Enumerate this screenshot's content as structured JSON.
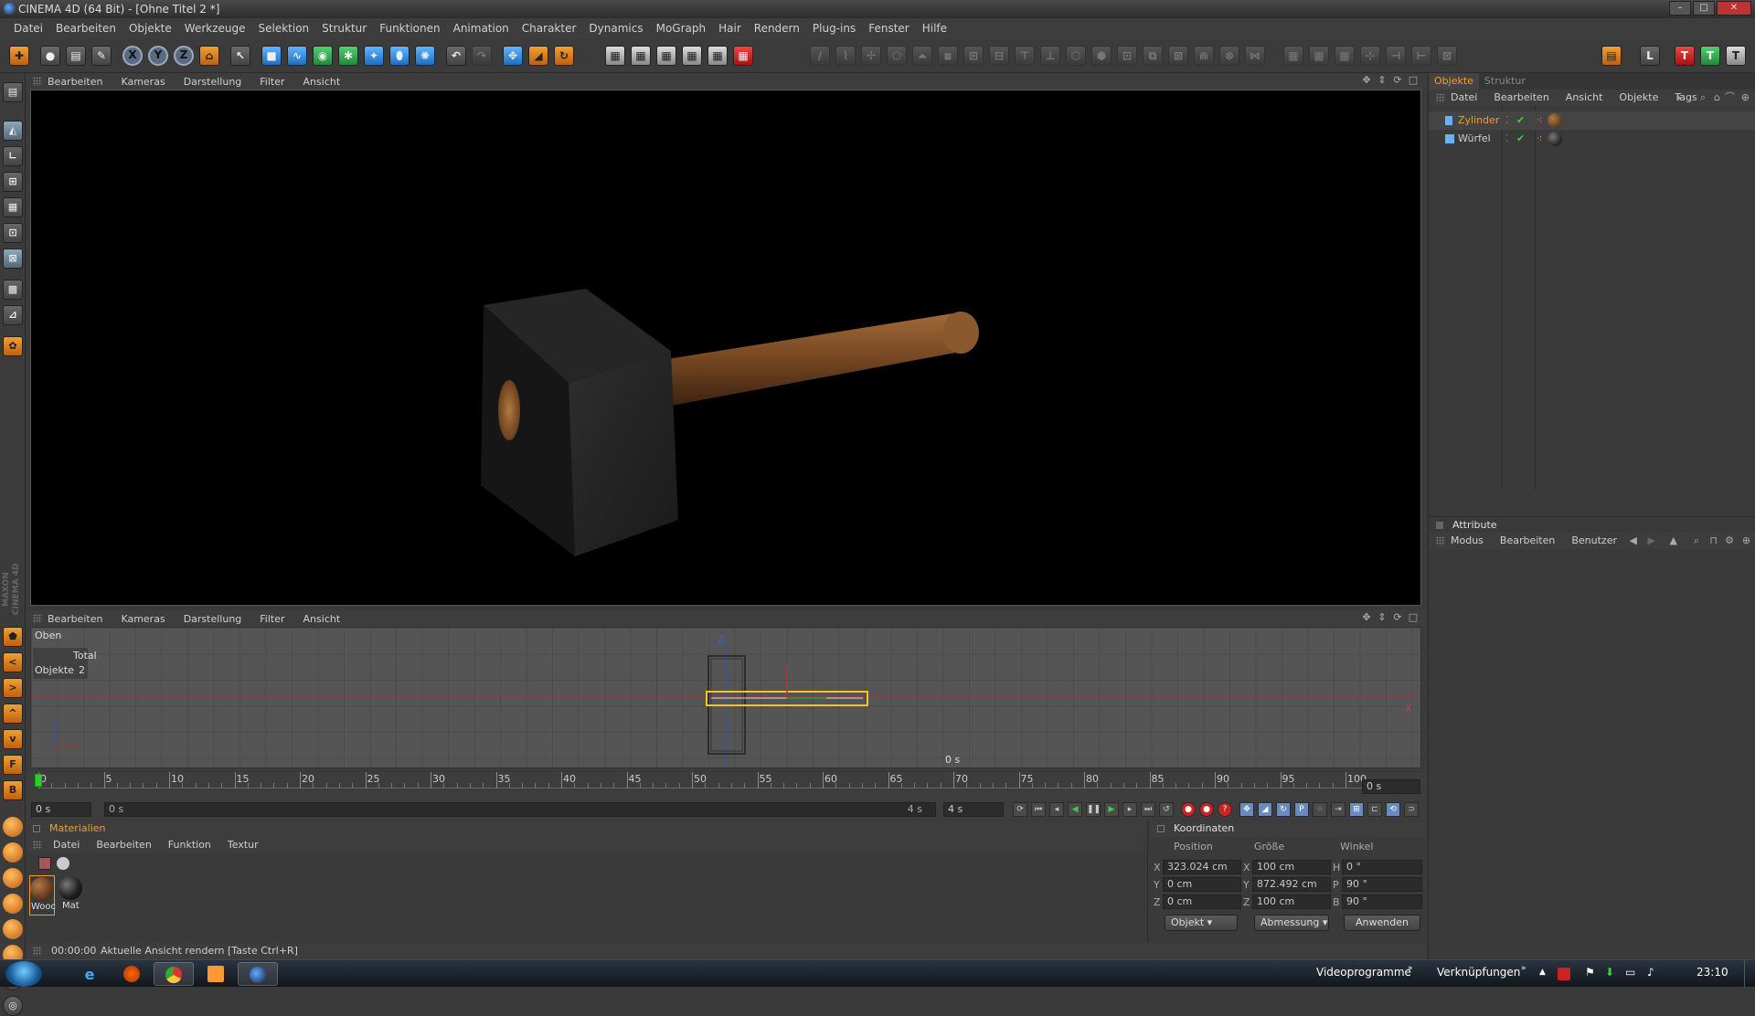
{
  "window": {
    "title": "CINEMA 4D (64 Bit) - [Ohne Titel 2 *]"
  },
  "menu": [
    "Datei",
    "Bearbeiten",
    "Objekte",
    "Werkzeuge",
    "Selektion",
    "Struktur",
    "Funktionen",
    "Animation",
    "Charakter",
    "Dynamics",
    "MoGraph",
    "Hair",
    "Rendern",
    "Plug-ins",
    "Fenster",
    "Hilfe"
  ],
  "viewport_top": {
    "menu": [
      "Bearbeiten",
      "Kameras",
      "Darstellung",
      "Filter",
      "Ansicht"
    ]
  },
  "viewport_bottom": {
    "menu": [
      "Bearbeiten",
      "Kameras",
      "Darstellung",
      "Filter",
      "Ansicht"
    ],
    "view_name": "Oben",
    "stats_header": "Total",
    "stats_label": "Objekte",
    "stats_value": "2",
    "time_label": "0 s",
    "axis_z": "Z",
    "axis_x": "X"
  },
  "timeline": {
    "ticks": [
      "0",
      "5",
      "10",
      "15",
      "20",
      "25",
      "30",
      "35",
      "40",
      "45",
      "50",
      "55",
      "60",
      "65",
      "70",
      "75",
      "80",
      "85",
      "90",
      "95",
      "100"
    ],
    "current": "0 s",
    "start_field": "0 s",
    "range_start": "0 s",
    "range_end": "4 s",
    "end_field": "4 s"
  },
  "materials": {
    "title": "Materialien",
    "menu": [
      "Datei",
      "Bearbeiten",
      "Funktion",
      "Textur"
    ],
    "items": [
      {
        "label": "Wooc",
        "color": "#6b3f1f"
      },
      {
        "label": "Mat",
        "color": "#222222"
      }
    ]
  },
  "coordinates": {
    "title": "Koordinaten",
    "headers": [
      "Position",
      "Größe",
      "Winkel"
    ],
    "rows": [
      {
        "axis": "X",
        "pos": "323.024 cm",
        "size_axis": "X",
        "size": "100 cm",
        "rot_axis": "H",
        "rot": "0 °"
      },
      {
        "axis": "Y",
        "pos": "0 cm",
        "size_axis": "Y",
        "size": "872.492 cm",
        "rot_axis": "P",
        "rot": "90 °"
      },
      {
        "axis": "Z",
        "pos": "0 cm",
        "size_axis": "Z",
        "size": "100 cm",
        "rot_axis": "B",
        "rot": "90 °"
      }
    ],
    "mode_select": "Objekt",
    "size_select": "Abmessung",
    "apply_button": "Anwenden"
  },
  "status": {
    "time": "00:00:00",
    "message": "Aktuelle Ansicht rendern [Taste Ctrl+R]"
  },
  "object_manager": {
    "tabs": [
      "Objekte",
      "Struktur"
    ],
    "menu": [
      "Datei",
      "Bearbeiten",
      "Ansicht",
      "Objekte",
      "Tags"
    ],
    "objects": [
      {
        "name": "Zylinder",
        "selected": true
      },
      {
        "name": "Würfel",
        "selected": false
      }
    ]
  },
  "attributes": {
    "title": "Attribute",
    "menu": [
      "Modus",
      "Bearbeiten",
      "Benutzer"
    ]
  },
  "brand": "MAXON CINEMA 4D",
  "taskbar": {
    "labels": [
      "Videoprogramme",
      "Verknüpfungen"
    ],
    "clock": "23:10"
  },
  "colors": {
    "accent": "#f0a030",
    "selection": "#f5c518",
    "wood": "#7a4a24"
  }
}
